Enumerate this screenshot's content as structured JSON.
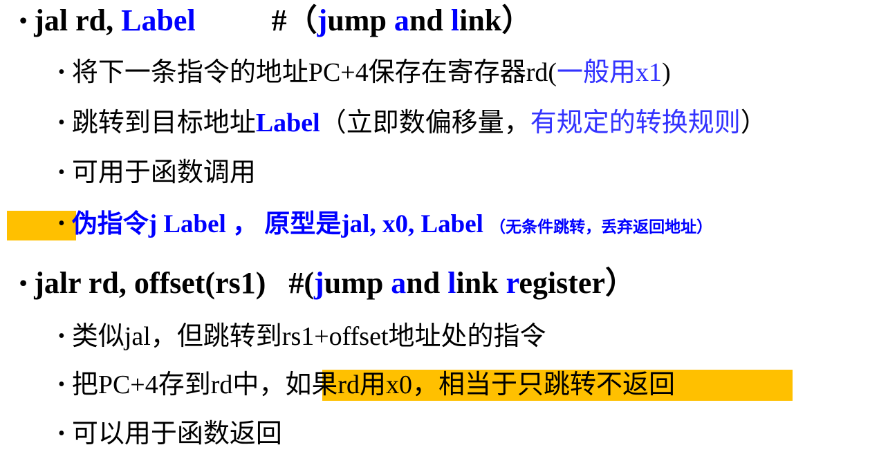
{
  "colors": {
    "blue": "#0000ff",
    "light_blue": "#3333ff",
    "highlight": "#ffc000"
  },
  "bullet": "•",
  "jal": {
    "head": [
      {
        "t": "jal rd, ",
        "c": "#000"
      },
      {
        "t": "Label",
        "c": "#0000ff"
      },
      {
        "t": "          #（",
        "c": "#000"
      },
      {
        "t": "j",
        "c": "#0000ff"
      },
      {
        "t": "ump ",
        "c": "#000"
      },
      {
        "t": "a",
        "c": "#0000ff"
      },
      {
        "t": "nd ",
        "c": "#000"
      },
      {
        "t": "l",
        "c": "#0000ff"
      },
      {
        "t": "ink）",
        "c": "#000"
      }
    ],
    "items": [
      [
        {
          "t": "将下一条指令的地址PC+4保存在寄存器rd(",
          "c": "#000"
        },
        {
          "t": "一般用x1",
          "c": "#3333ff"
        },
        {
          "t": ")",
          "c": "#000"
        }
      ],
      [
        {
          "t": "跳转到目标地址",
          "c": "#000"
        },
        {
          "t": "Label",
          "c": "#0000ff",
          "b": true
        },
        {
          "t": "（立即数偏移量，",
          "c": "#000"
        },
        {
          "t": "有规定的转换规则",
          "c": "#3333ff"
        },
        {
          "t": "）",
          "c": "#000"
        }
      ],
      [
        {
          "t": "可用于函数调用",
          "c": "#000"
        }
      ],
      [
        {
          "t": "伪指令j Label ， 原型是jal, x0, Label ",
          "c": "#0000ff",
          "b": true
        },
        {
          "t": "（无条件跳转，丢弃返回地址）",
          "c": "#0000ff",
          "b": true,
          "s": true
        }
      ]
    ]
  },
  "jalr": {
    "head": [
      {
        "t": "jalr rd, offset(rs1)   #(",
        "c": "#000"
      },
      {
        "t": "j",
        "c": "#0000ff"
      },
      {
        "t": "ump ",
        "c": "#000"
      },
      {
        "t": "a",
        "c": "#0000ff"
      },
      {
        "t": "nd ",
        "c": "#000"
      },
      {
        "t": "l",
        "c": "#0000ff"
      },
      {
        "t": "ink ",
        "c": "#000"
      },
      {
        "t": "r",
        "c": "#0000ff"
      },
      {
        "t": "egister）",
        "c": "#000"
      }
    ],
    "items": [
      [
        {
          "t": "类似jal，但跳转到rs1+offset地址处的指令",
          "c": "#000"
        }
      ],
      [
        {
          "t": "把PC+4存到rd中，",
          "c": "#000"
        },
        {
          "t": "如果rd用x0，相当于只跳转不返回",
          "c": "#000"
        }
      ],
      [
        {
          "t": "可以用于函数返回",
          "c": "#000"
        }
      ]
    ]
  }
}
